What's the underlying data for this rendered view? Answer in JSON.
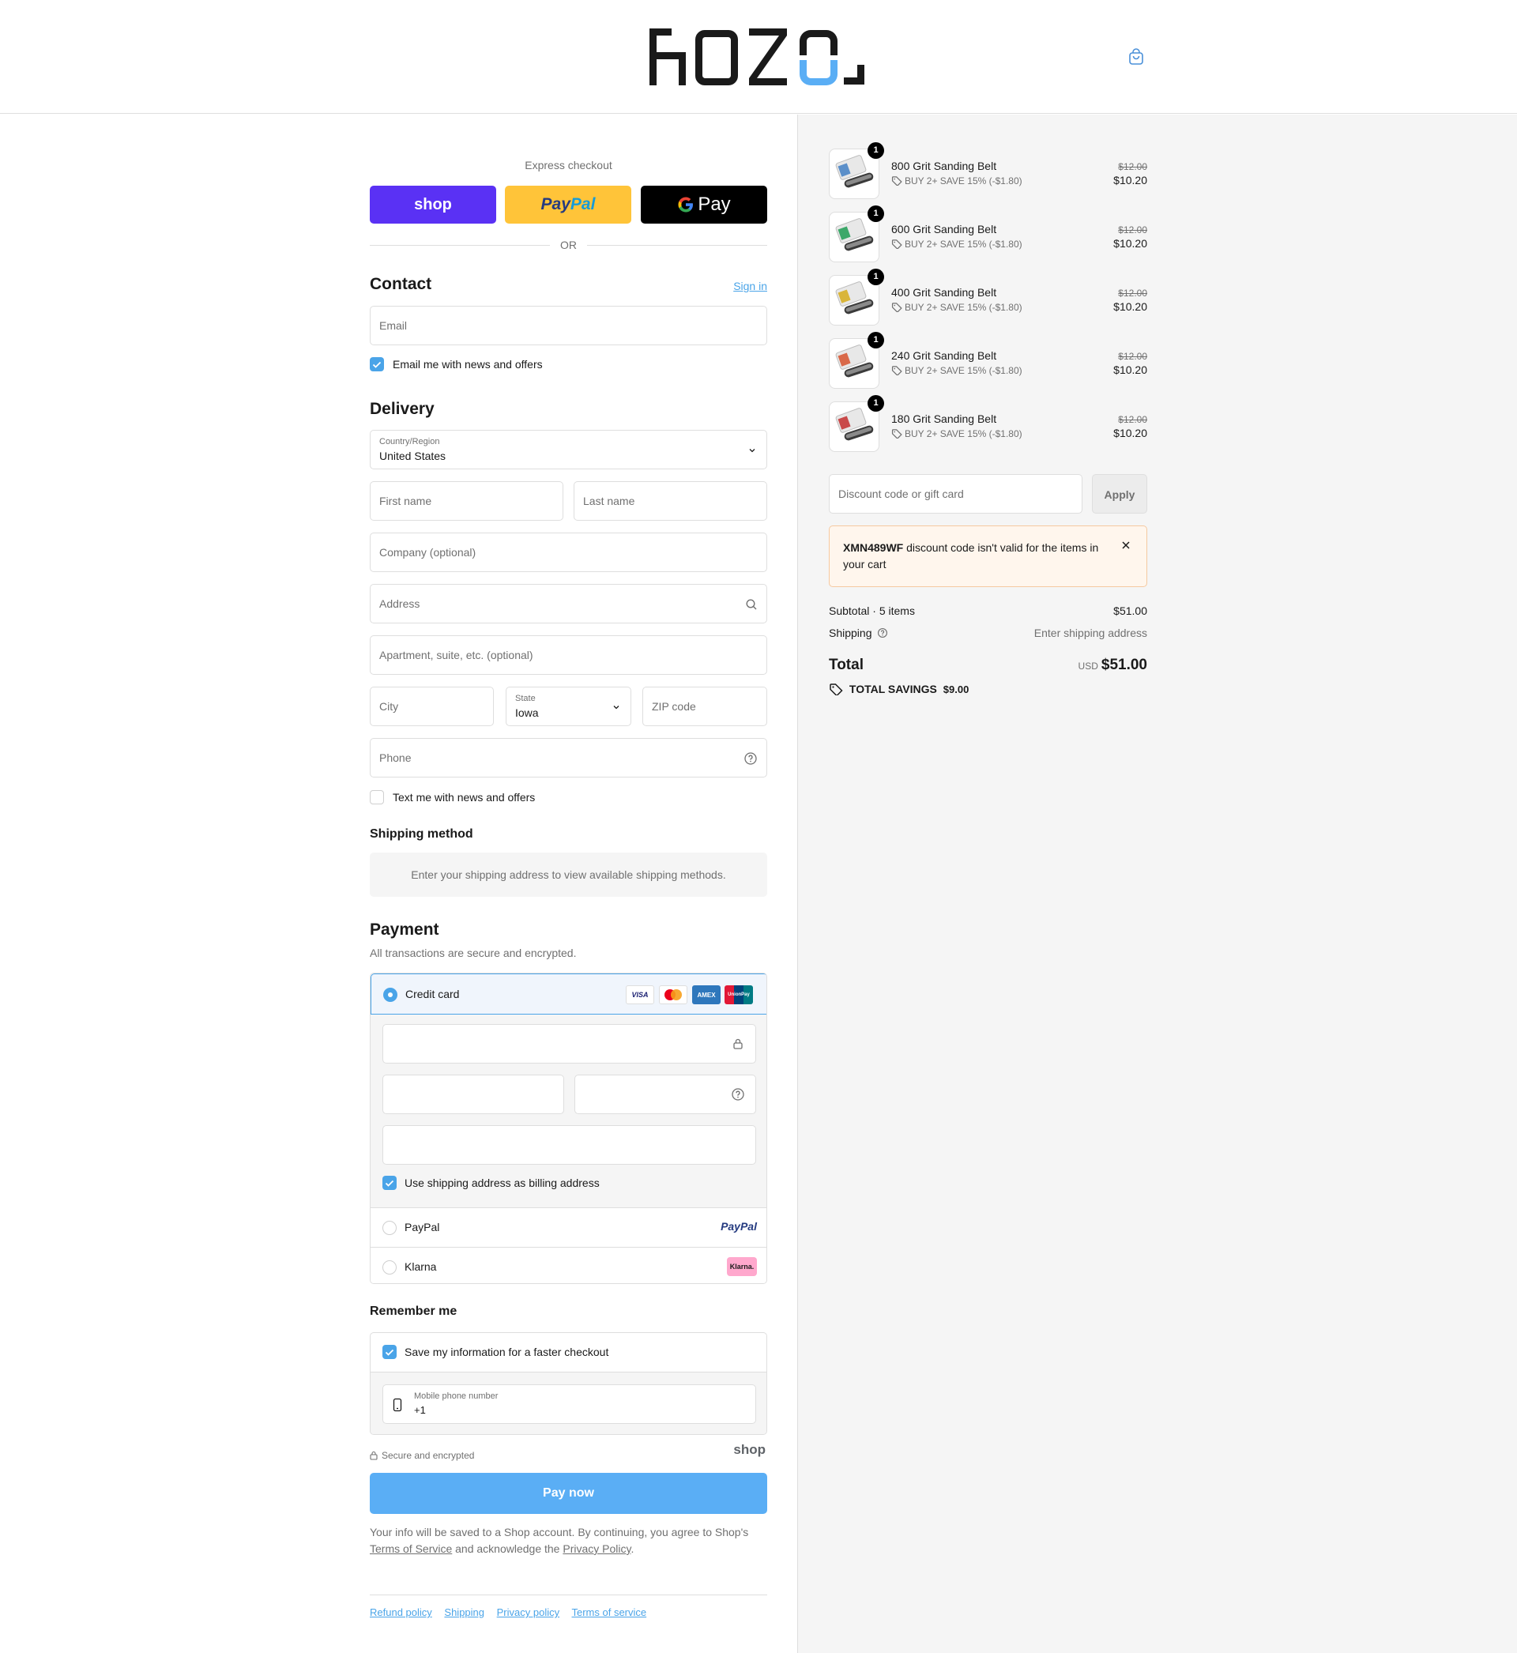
{
  "brand": {
    "logo_text": "HOZO"
  },
  "express": {
    "title": "Express checkout",
    "shop_label": "shop",
    "paypal_label": "PayPal",
    "gpay_label": "Pay",
    "or_label": "OR"
  },
  "contact": {
    "heading": "Contact",
    "sign_in": "Sign in",
    "email_placeholder": "Email",
    "news_label": "Email me with news and offers"
  },
  "delivery": {
    "heading": "Delivery",
    "country_label": "Country/Region",
    "country_value": "United States",
    "first_name": "First name",
    "last_name": "Last name",
    "company": "Company (optional)",
    "address": "Address",
    "apartment": "Apartment, suite, etc. (optional)",
    "city": "City",
    "state_label": "State",
    "state_value": "Iowa",
    "zip": "ZIP code",
    "phone": "Phone",
    "text_label": "Text me with news and offers"
  },
  "shipping_method": {
    "heading": "Shipping method",
    "message": "Enter your shipping address to view available shipping methods."
  },
  "payment": {
    "heading": "Payment",
    "subtitle": "All transactions are secure and encrypted.",
    "credit_card_label": "Credit card",
    "card_logos": [
      "VISA",
      "MC",
      "AMEX",
      "UnionPay"
    ],
    "billing_label": "Use shipping address as billing address",
    "paypal_label": "PayPal",
    "paypal_logo": "PayPal",
    "klarna_label": "Klarna",
    "klarna_logo": "Klarna."
  },
  "remember": {
    "heading": "Remember me",
    "save_label": "Save my information for a faster checkout",
    "mobile_label": "Mobile phone number",
    "mobile_value": "+1",
    "secure_label": "Secure and encrypted",
    "shop_logo": "shop"
  },
  "pay_now": "Pay now",
  "legal": {
    "text1": "Your info will be saved to a Shop account. By continuing, you agree to Shop's",
    "terms": "Terms of Service",
    "text2": "and acknowledge the",
    "privacy": "Privacy Policy",
    "end": "."
  },
  "footer_links": [
    "Refund policy",
    "Shipping",
    "Privacy policy",
    "Terms of service"
  ],
  "cart": {
    "items": [
      {
        "name": "800 Grit Sanding Belt",
        "discount": "BUY 2+ SAVE 15% (-$1.80)",
        "old_price": "$12.00",
        "price": "$10.20",
        "qty": "1",
        "color": "#5b8fc9"
      },
      {
        "name": "600 Grit Sanding Belt",
        "discount": "BUY 2+ SAVE 15% (-$1.80)",
        "old_price": "$12.00",
        "price": "$10.20",
        "qty": "1",
        "color": "#3da86a"
      },
      {
        "name": "400 Grit Sanding Belt",
        "discount": "BUY 2+ SAVE 15% (-$1.80)",
        "old_price": "$12.00",
        "price": "$10.20",
        "qty": "1",
        "color": "#d9b53a"
      },
      {
        "name": "240 Grit Sanding Belt",
        "discount": "BUY 2+ SAVE 15% (-$1.80)",
        "old_price": "$12.00",
        "price": "$10.20",
        "qty": "1",
        "color": "#d9694a"
      },
      {
        "name": "180 Grit Sanding Belt",
        "discount": "BUY 2+ SAVE 15% (-$1.80)",
        "old_price": "$12.00",
        "price": "$10.20",
        "qty": "1",
        "color": "#c94a4a"
      }
    ],
    "discount_placeholder": "Discount code or gift card",
    "apply_label": "Apply",
    "error_code": "XMN489WF",
    "error_msg": " discount code isn't valid for the items in your cart",
    "subtotal_label": "Subtotal · 5 items",
    "subtotal_value": "$51.00",
    "shipping_label": "Shipping",
    "shipping_value": "Enter shipping address",
    "total_label": "Total",
    "currency": "USD",
    "total_value": "$51.00",
    "savings_label": "TOTAL SAVINGS",
    "savings_value": "$9.00"
  }
}
